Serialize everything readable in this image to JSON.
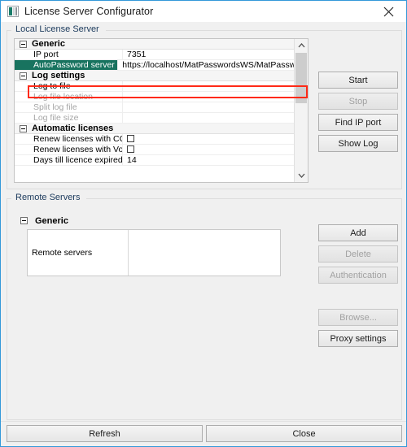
{
  "window": {
    "title": "License Server Configurator",
    "icon": "app-window-icon",
    "close_label": "✕",
    "border_color": "#3399d9"
  },
  "local_group": {
    "label": "Local License Server",
    "grid": {
      "rows": [
        {
          "type": "category",
          "name": "Generic",
          "value": "",
          "dim": false,
          "selected": false
        },
        {
          "type": "prop",
          "name": "IP port",
          "value": "7351",
          "dim": false,
          "selected": false
        },
        {
          "type": "prop",
          "name": "AutoPassword server URL",
          "value": "https://localhost/MatPasswordsWS/MatPasswor",
          "dim": false,
          "selected": true
        },
        {
          "type": "category",
          "name": "Log settings",
          "value": "",
          "dim": false,
          "selected": false
        },
        {
          "type": "prop",
          "name": "Log to file",
          "value": "",
          "dim": false,
          "selected": false
        },
        {
          "type": "prop",
          "name": "Log file location",
          "value": "",
          "dim": true,
          "selected": false
        },
        {
          "type": "prop",
          "name": "Split log file",
          "value": "",
          "dim": true,
          "selected": false
        },
        {
          "type": "prop",
          "name": "Log file size",
          "value": "",
          "dim": true,
          "selected": false
        },
        {
          "type": "category",
          "name": "Automatic licenses",
          "value": "",
          "dim": false,
          "selected": false
        },
        {
          "type": "checkbox",
          "name": "Renew licenses with CC-key",
          "value": "",
          "checked": false,
          "dim": false,
          "selected": false
        },
        {
          "type": "checkbox",
          "name": "Renew licenses with Vouch...",
          "value": "",
          "checked": false,
          "dim": false,
          "selected": false
        },
        {
          "type": "prop",
          "name": "Days till licence expired",
          "value": "14",
          "dim": false,
          "selected": false
        }
      ],
      "highlight_color": "#ff2a17",
      "selected_row_color": "#18735f"
    },
    "scrollbar": {
      "up_arrow": "chevron-up-icon",
      "down_arrow": "chevron-down-icon"
    },
    "buttons": [
      {
        "label": "Start",
        "enabled": true
      },
      {
        "label": "Stop",
        "enabled": false
      },
      {
        "label": "Find IP port",
        "enabled": true
      },
      {
        "label": "Show Log",
        "enabled": true
      }
    ]
  },
  "remote_group": {
    "label": "Remote Servers",
    "category": "Generic",
    "row_label": "Remote servers",
    "row_value": "",
    "buttons": [
      {
        "label": "Add",
        "enabled": true
      },
      {
        "label": "Delete",
        "enabled": false
      },
      {
        "label": "Authentication",
        "enabled": false
      },
      {
        "label": "Browse...",
        "enabled": false
      },
      {
        "label": "Proxy settings",
        "enabled": true
      }
    ]
  },
  "footer": {
    "refresh_label": "Refresh",
    "close_label": "Close"
  }
}
